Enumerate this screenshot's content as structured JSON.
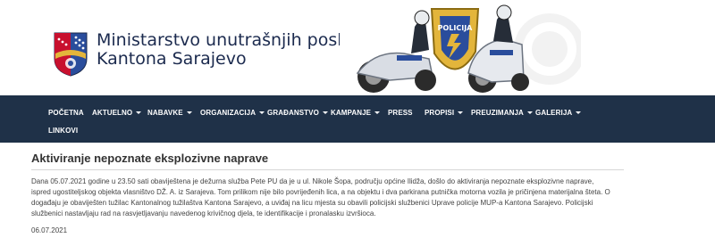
{
  "header": {
    "title_line1": "Ministarstvo unutrašnjih poslova",
    "title_line2": "Kantona Sarajevo",
    "logo_icon": "coat-of-arms-icon",
    "banner_icon": "police-motorcycles-banner",
    "badge_text": "POLICIJA",
    "colors": {
      "title": "#1b2a4e",
      "accent_blue": "#2a4d9c",
      "accent_red": "#c8102e",
      "badge_gold": "#e3b53b"
    }
  },
  "nav": {
    "background": "#1f3148",
    "items": [
      {
        "label": "POČETNA",
        "dropdown": false
      },
      {
        "label": "AKTUELNO",
        "dropdown": true
      },
      {
        "label": "NABAVKE",
        "dropdown": true
      },
      {
        "label": "ORGANIZACIJA",
        "dropdown": true
      },
      {
        "label": "GRAĐANSTVO",
        "dropdown": true
      },
      {
        "label": "KAMPANJE",
        "dropdown": true
      },
      {
        "label": "PRESS",
        "dropdown": false
      },
      {
        "label": "PROPISI",
        "dropdown": true
      },
      {
        "label": "PREUZIMANJA",
        "dropdown": true
      },
      {
        "label": "GALERIJA",
        "dropdown": true
      },
      {
        "label": "LINKOVI",
        "dropdown": false
      }
    ]
  },
  "article": {
    "title": "Aktiviranje nepoznate eksplozivne naprave",
    "body_lines": [
      "Dana 05.07.2021 godine u 23.50 sati obaviještena je dežurna služba Pete PU da je u ul. Nikole Šopa, području općine Ilidža, došlo do aktiviranja nepoznate eksplozivne naprave,",
      "ispred ugostiteljskog objekta vlasništvo DŽ. A. iz Sarajeva. Tom prilikom nije bilo povrijeđenih lica, a na objektu i dva parkirana putnička motorna vozila je pričinjena materijalna šteta. O",
      "događaju je obaviješten tužilac Kantonalnog tužilaštva Kantona Sarajevo, a uviđaj na licu mjesta su obavili policijski službenici Uprave policije MUP-a Kantona Sarajevo. Policijski",
      "službenici nastavljaju rad na rasvjetljavanju navedenog krivičnog djela, te identifikacije i pronalasku izvršioca."
    ],
    "date": "06.07.2021"
  }
}
